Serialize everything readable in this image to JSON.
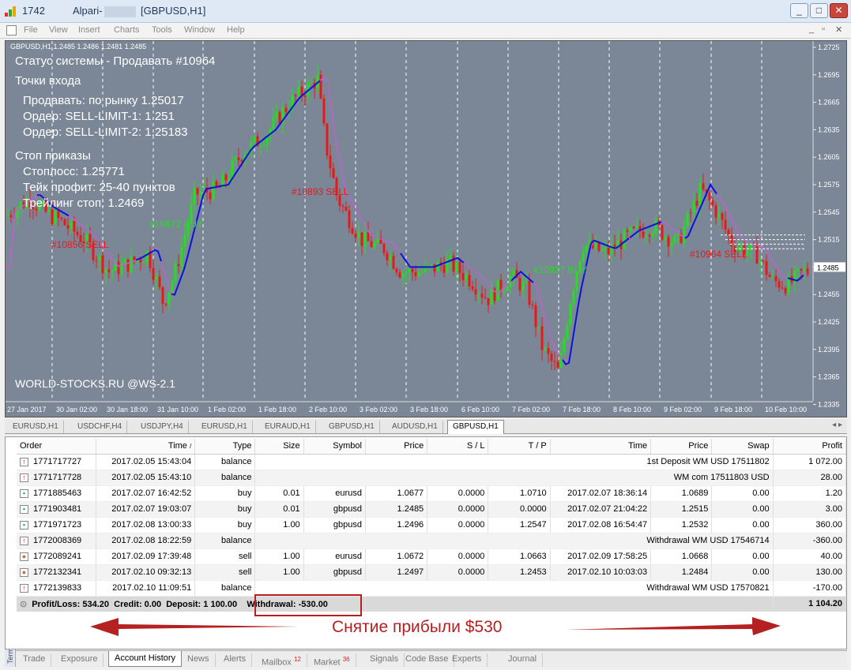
{
  "window": {
    "title_number": "1742",
    "title_broker": "Alpari-",
    "title_chart": "[GBPUSD,H1]",
    "buttons": [
      "_",
      "□",
      "✕"
    ]
  },
  "menu": [
    "File",
    "View",
    "Insert",
    "Charts",
    "Tools",
    "Window",
    "Help"
  ],
  "chart": {
    "symbol_line": "GBPUSD,H1  1.2485 1.2486 1.2481 1.2485",
    "status": "Статус системы - Продавать #10964",
    "entries_title": "Точки входа",
    "entry1": "Продавать: по рынку 1.25017",
    "entry2": "Ордер: SELL-LIMIT-1: 1.251",
    "entry3": "Ордер: SELL-LIMIT-2: 1.25183",
    "stops_title": "Стоп приказы",
    "stop1": "Стоплосс: 1.25771",
    "stop2": "Тейк профит: 25-40 пунктов",
    "stop3": "Трейлинг стоп: 1.2469",
    "watermark": "WORLD-STOCKS.RU @WS-2.1",
    "signals": [
      "#10856 SELL",
      "#10872 BUY",
      "#10893 SELL",
      "#10937 BUY",
      "#10964 SELL"
    ],
    "price_labels": [
      "1.2725",
      "1.2695",
      "1.2665",
      "1.2635",
      "1.2605",
      "1.2575",
      "1.2545",
      "1.2515",
      "1.2485",
      "1.2455",
      "1.2425",
      "1.2395",
      "1.2365",
      "1.2335"
    ],
    "current_price": "1.2485",
    "time_labels": [
      "27 Jan 2017",
      "30 Jan 02:00",
      "30 Jan 18:00",
      "31 Jan 10:00",
      "1 Feb 02:00",
      "1 Feb 18:00",
      "2 Feb 10:00",
      "3 Feb 02:00",
      "3 Feb 18:00",
      "6 Feb 10:00",
      "7 Feb 02:00",
      "7 Feb 18:00",
      "8 Feb 10:00",
      "9 Feb 02:00",
      "9 Feb 18:00",
      "10 Feb 10:00"
    ],
    "colors": {
      "bg": "#7b8797",
      "bull": "#22e01d",
      "bear": "#e81818",
      "ma_blue": "#0a14d8",
      "ma_violet": "#c060d0"
    }
  },
  "chart_tabs": [
    "EURUSD,H1",
    "USDCHF,H4",
    "USDJPY,H4",
    "EURUSD,H1",
    "EURAUD,H1",
    "GBPUSD,H1",
    "AUDUSD,H1",
    "GBPUSD,H1"
  ],
  "table": {
    "headers": [
      "Order",
      "Time",
      "Type",
      "Size",
      "Symbol",
      "Price",
      "S / L",
      "T / P",
      "Time",
      "Price",
      "Swap",
      "Profit"
    ],
    "rows": [
      {
        "icon": "balance",
        "order": "1771717727",
        "time": "2017.02.05 15:43:04",
        "type": "balance",
        "comment": "1st Deposit WM USD 17511802",
        "profit": "1 072.00"
      },
      {
        "icon": "balance",
        "order": "1771717728",
        "time": "2017.02.05 15:43:10",
        "type": "balance",
        "comment": "WM com 17511803 USD",
        "profit": "28.00"
      },
      {
        "icon": "buy",
        "order": "1771885463",
        "time": "2017.02.07 16:42:52",
        "type": "buy",
        "size": "0.01",
        "symbol": "eurusd",
        "price": "1.0677",
        "sl": "0.0000",
        "tp": "1.0710",
        "ctime": "2017.02.07 18:36:14",
        "cprice": "1.0689",
        "swap": "0.00",
        "profit": "1.20"
      },
      {
        "icon": "buy",
        "order": "1771903481",
        "time": "2017.02.07 19:03:07",
        "type": "buy",
        "size": "0.01",
        "symbol": "gbpusd",
        "price": "1.2485",
        "sl": "0.0000",
        "tp": "0.0000",
        "ctime": "2017.02.07 21:04:22",
        "cprice": "1.2515",
        "swap": "0.00",
        "profit": "3.00"
      },
      {
        "icon": "buy",
        "order": "1771971723",
        "time": "2017.02.08 13:00:33",
        "type": "buy",
        "size": "1.00",
        "symbol": "gbpusd",
        "price": "1.2496",
        "sl": "0.0000",
        "tp": "1.2547",
        "ctime": "2017.02.08 16:54:47",
        "cprice": "1.2532",
        "swap": "0.00",
        "profit": "360.00"
      },
      {
        "icon": "balance",
        "order": "1772008369",
        "time": "2017.02.08 18:22:59",
        "type": "balance",
        "comment": "Withdrawal WM USD 17546714",
        "profit": "-360.00"
      },
      {
        "icon": "sell",
        "order": "1772089241",
        "time": "2017.02.09 17:39:48",
        "type": "sell",
        "size": "1.00",
        "symbol": "eurusd",
        "price": "1.0672",
        "sl": "0.0000",
        "tp": "1.0663",
        "ctime": "2017.02.09 17:58:25",
        "cprice": "1.0668",
        "swap": "0.00",
        "profit": "40.00"
      },
      {
        "icon": "sell",
        "order": "1772132341",
        "time": "2017.02.10 09:32:13",
        "type": "sell",
        "size": "1.00",
        "symbol": "gbpusd",
        "price": "1.2497",
        "sl": "0.0000",
        "tp": "1.2453",
        "ctime": "2017.02.10 10:03:03",
        "cprice": "1.2484",
        "swap": "0.00",
        "profit": "130.00"
      },
      {
        "icon": "balance",
        "order": "1772139833",
        "time": "2017.02.10 11:09:51",
        "type": "balance",
        "comment": "Withdrawal WM USD 17570821",
        "profit": "-170.00"
      }
    ],
    "summary": {
      "pl": "Profit/Loss: 534.20",
      "credit": "Credit: 0.00",
      "deposit": "Deposit: 1 100.00",
      "withdrawal": "Withdrawal: -530.00",
      "total": "1 104.20"
    }
  },
  "annotation": "Снятие прибыли   $530",
  "bottom_tabs": [
    {
      "label": "Trade"
    },
    {
      "label": "Exposure"
    },
    {
      "label": "Account History",
      "active": true
    },
    {
      "label": "News"
    },
    {
      "label": "Alerts"
    },
    {
      "label": "Mailbox",
      "badge": "12"
    },
    {
      "label": "Market",
      "badge": "36"
    },
    {
      "label": "Signals"
    },
    {
      "label": "Code Base"
    },
    {
      "label": "Experts"
    },
    {
      "label": "Journal"
    }
  ],
  "terminal_label": "Terminal"
}
